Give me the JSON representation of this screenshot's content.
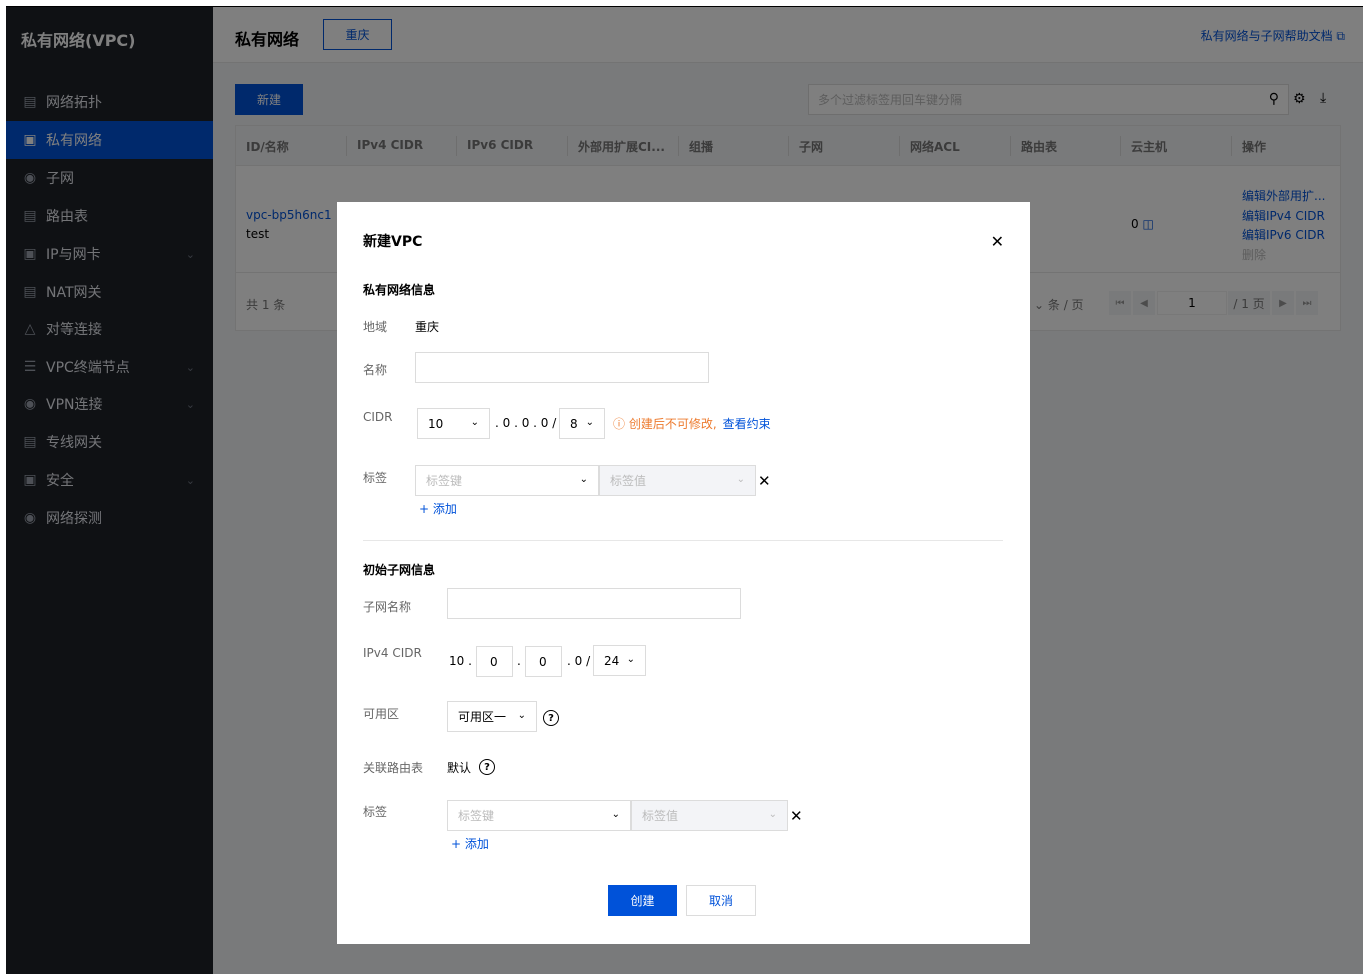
{
  "sidebar": {
    "title": "私有网络(VPC)",
    "items": [
      {
        "label": "网络拓扑",
        "icon": "topology-icon"
      },
      {
        "label": "私有网络",
        "icon": "vpc-icon",
        "active": true
      },
      {
        "label": "子网",
        "icon": "subnet-icon"
      },
      {
        "label": "路由表",
        "icon": "route-table-icon"
      },
      {
        "label": "IP与网卡",
        "icon": "ip-nic-icon",
        "expandable": true
      },
      {
        "label": "NAT网关",
        "icon": "nat-icon"
      },
      {
        "label": "对等连接",
        "icon": "peering-icon"
      },
      {
        "label": "VPC终端节点",
        "icon": "endpoint-icon",
        "expandable": true
      },
      {
        "label": "VPN连接",
        "icon": "vpn-icon",
        "expandable": true
      },
      {
        "label": "专线网关",
        "icon": "dc-gateway-icon"
      },
      {
        "label": "安全",
        "icon": "security-icon",
        "expandable": true
      },
      {
        "label": "网络探测",
        "icon": "probe-icon"
      }
    ]
  },
  "header": {
    "title": "私有网络",
    "region": "重庆",
    "help_link": "私有网络与子网帮助文档 ⧉"
  },
  "toolbar": {
    "new_label": "新建",
    "search_placeholder": "多个过滤标签用回车键分隔"
  },
  "table": {
    "columns": [
      "ID/名称",
      "IPv4 CIDR",
      "IPv6 CIDR",
      "外部用扩展CI...",
      "组播",
      "子网",
      "网络ACL",
      "路由表",
      "云主机",
      "操作"
    ],
    "row": {
      "id": "vpc-bp5h6nc1",
      "name": "test",
      "cvm_count": "0",
      "actions": [
        "编辑外部用扩...",
        "编辑IPv4 CIDR",
        "编辑IPv6 CIDR",
        "删除"
      ]
    },
    "footer": {
      "total": "共 1 条",
      "per_page": "条 / 页",
      "page": "1",
      "pages": "/ 1 页"
    }
  },
  "modal": {
    "title": "新建VPC",
    "vpc_section": "私有网络信息",
    "region_label": "地域",
    "region_value": "重庆",
    "name_label": "名称",
    "name_value": "",
    "cidr_label": "CIDR",
    "cidr_first": "10",
    "cidr_middle": ". 0 . 0 . 0 /",
    "cidr_mask": "8",
    "cidr_warning": "创建后不可修改,",
    "cidr_warning_link": "查看约束",
    "tag_label": "标签",
    "tag_key_placeholder": "标签键",
    "tag_value_placeholder": "标签值",
    "add_label": "+ 添加",
    "subnet_section": "初始子网信息",
    "subnet_name_label": "子网名称",
    "subnet_name_value": "",
    "ipv4_label": "IPv4 CIDR",
    "ipv4_first": "10",
    "ipv4_second": "0",
    "ipv4_third": "0",
    "ipv4_fourth": "0 /",
    "ipv4_mask": "24",
    "zone_label": "可用区",
    "zone_value": "可用区一",
    "route_label": "关联路由表",
    "route_value": "默认",
    "create_label": "创建",
    "cancel_label": "取消"
  }
}
